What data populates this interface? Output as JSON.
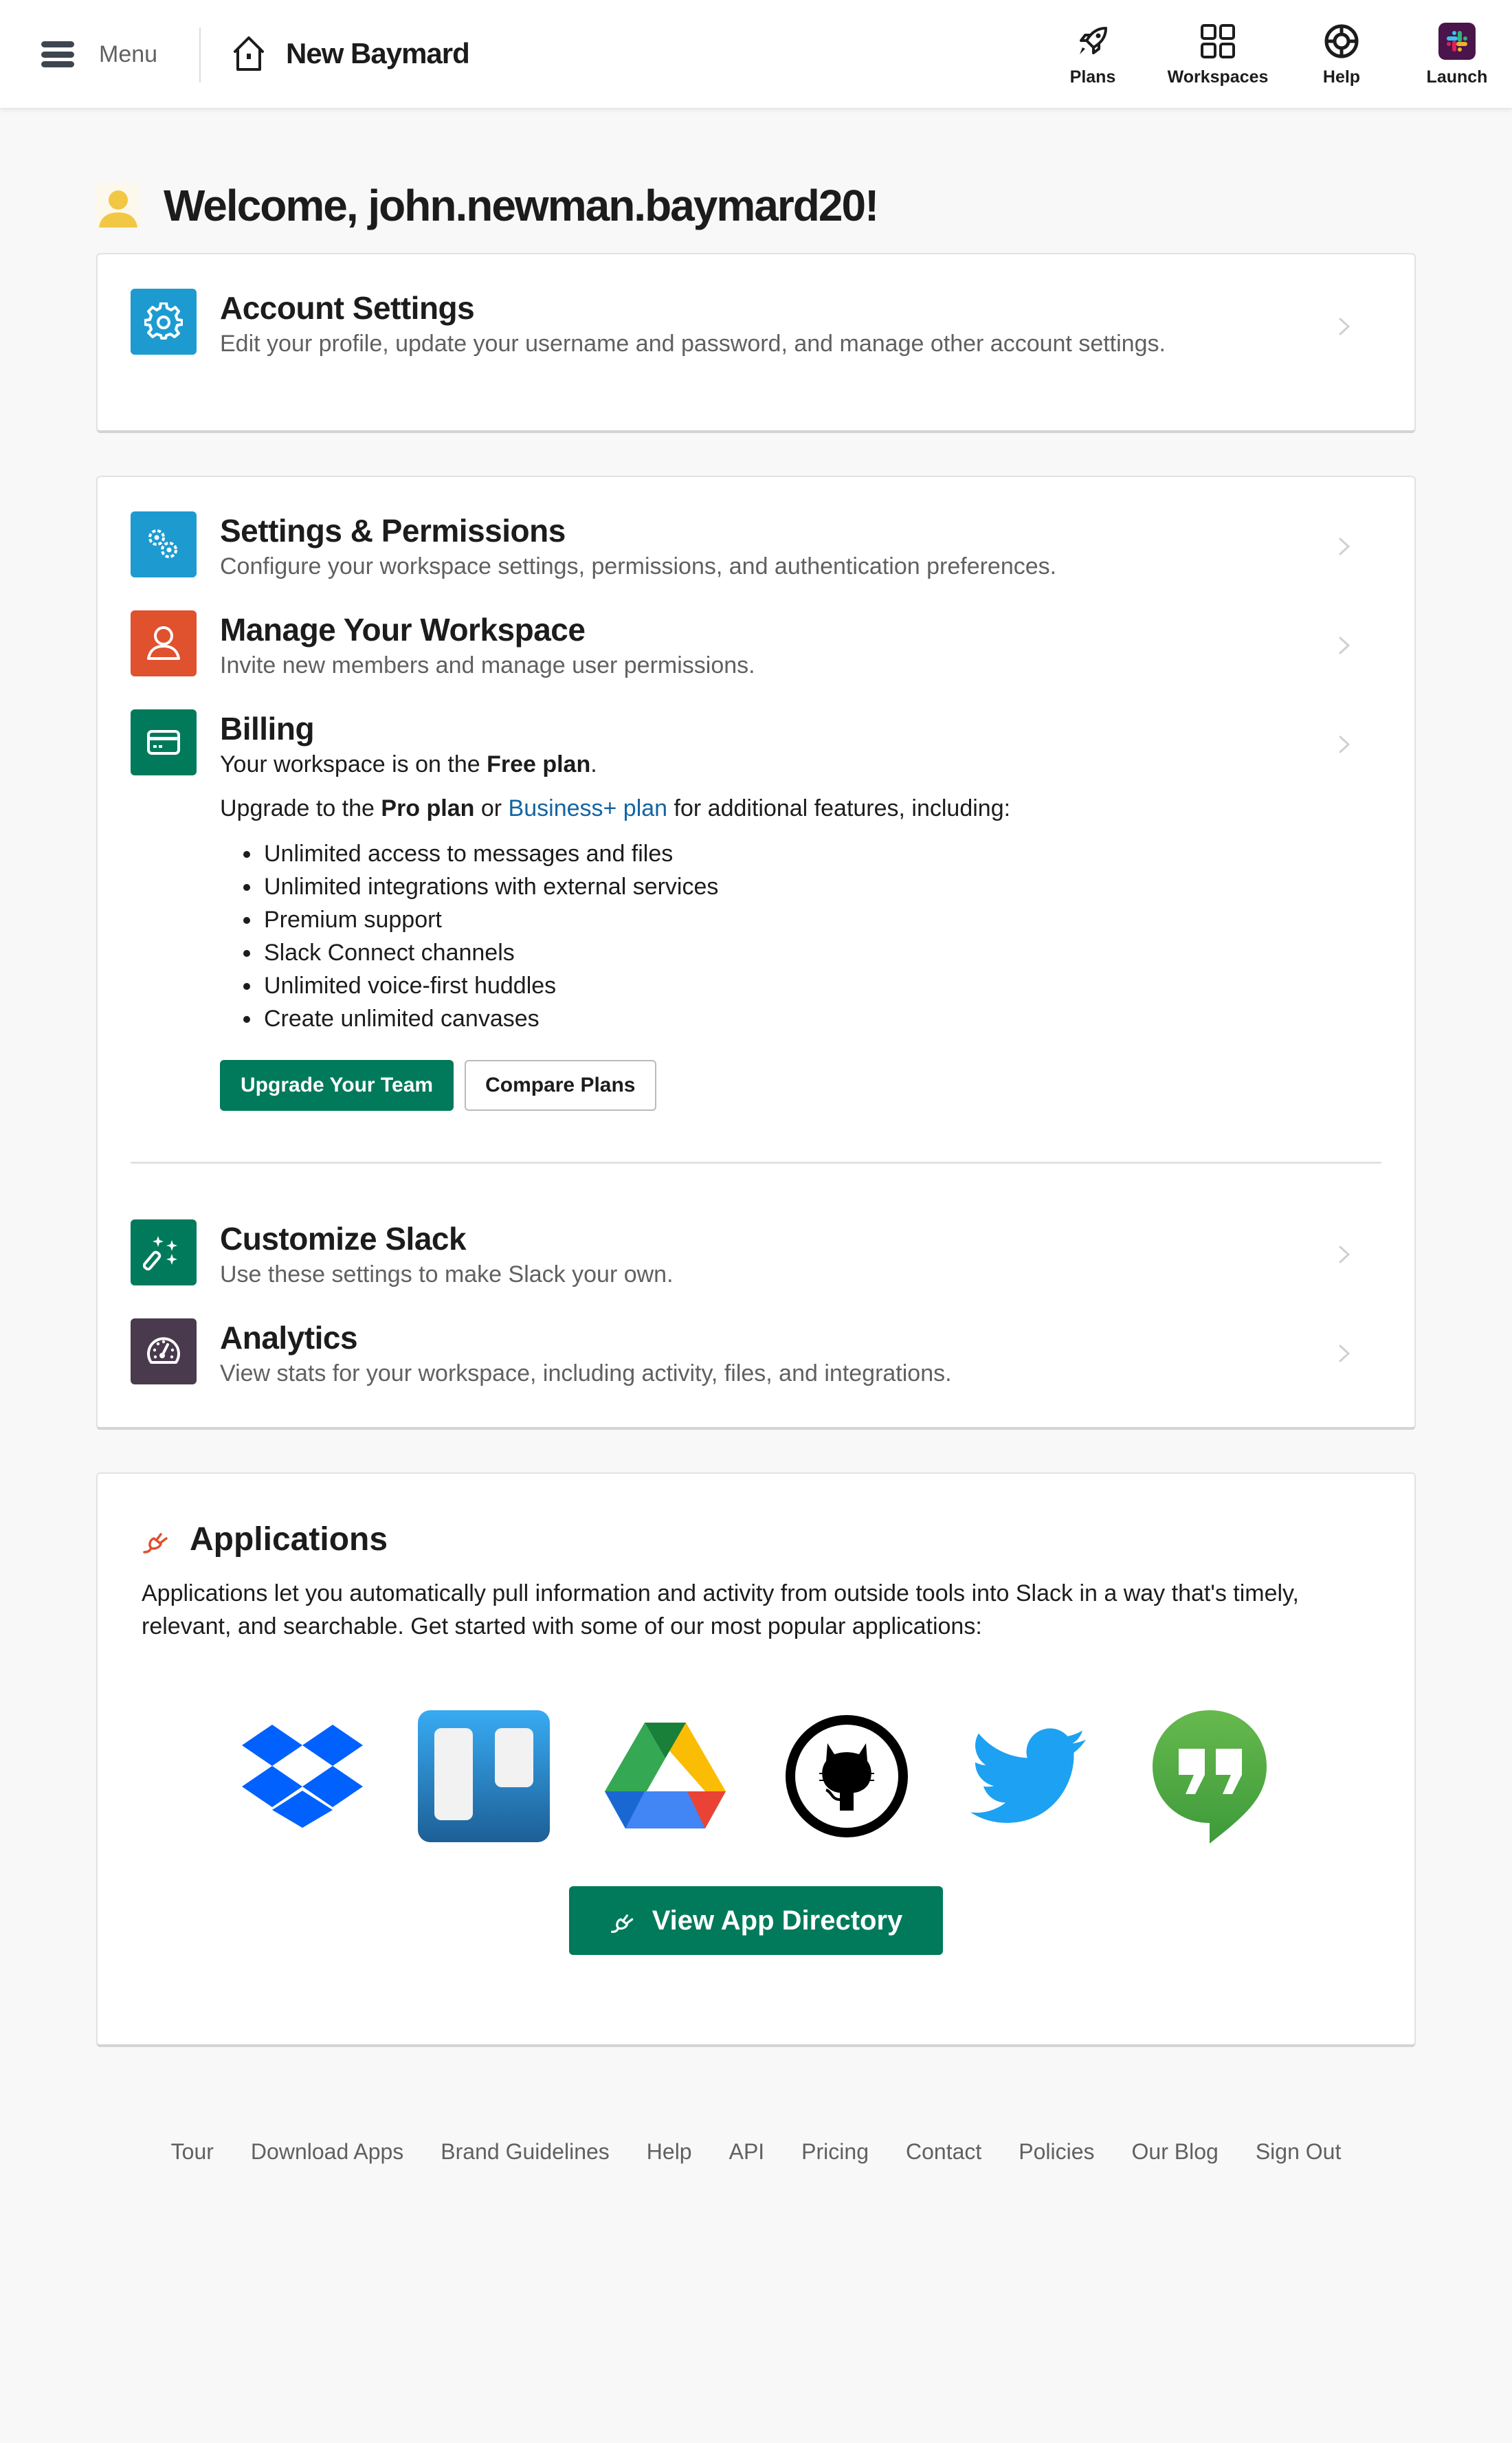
{
  "topbar": {
    "menu_label": "Menu",
    "workspace_name": "New Baymard",
    "nav": [
      {
        "label": "Plans",
        "icon": "rocket-icon"
      },
      {
        "label": "Workspaces",
        "icon": "grid-icon"
      },
      {
        "label": "Help",
        "icon": "lifebuoy-icon"
      },
      {
        "label": "Launch",
        "icon": "slack-logo-icon"
      }
    ]
  },
  "welcome": {
    "title": "Welcome, john.newman.baymard20!",
    "avatar_color": "#f2c744"
  },
  "account_settings": {
    "title": "Account Settings",
    "description": "Edit your profile, update your username and password, and manage other account settings.",
    "icon": "gear-icon",
    "color": "#1d9bd1"
  },
  "workspace_sections": [
    {
      "title": "Settings & Permissions",
      "description": "Configure your workspace settings, permissions, and authentication preferences.",
      "icon": "gears-icon",
      "color": "#1d9bd1"
    },
    {
      "title": "Manage Your Workspace",
      "description": "Invite new members and manage user permissions.",
      "icon": "user-icon",
      "color": "#e0512e"
    },
    {
      "title": "Billing",
      "icon": "credit-card-icon",
      "color": "#007a5a"
    }
  ],
  "billing": {
    "current_plan_prefix": "Your workspace is on the ",
    "current_plan": "Free plan",
    "current_plan_suffix": ".",
    "upgrade_prefix": "Upgrade to the ",
    "pro_plan": "Pro plan",
    "or": " or ",
    "business_plan": "Business+ plan",
    "upgrade_suffix": " for additional features, including:",
    "features": [
      "Unlimited access to messages and files",
      "Unlimited integrations with external services",
      "Premium support",
      "Slack Connect channels",
      "Unlimited voice-first huddles",
      "Create unlimited canvases"
    ],
    "upgrade_button": "Upgrade Your Team",
    "compare_button": "Compare Plans"
  },
  "customize_sections": [
    {
      "title": "Customize Slack",
      "description": "Use these settings to make Slack your own.",
      "icon": "magic-wand-icon",
      "color": "#007a5a"
    },
    {
      "title": "Analytics",
      "description": "View stats for your workspace, including activity, files, and integrations.",
      "icon": "speedometer-icon",
      "color": "#4a3a4e"
    }
  ],
  "applications": {
    "title": "Applications",
    "description": "Applications let you automatically pull information and activity from outside tools into Slack in a way that's timely, relevant, and searchable. Get started with some of our most popular applications:",
    "apps": [
      "Dropbox",
      "Trello",
      "Google Drive",
      "GitHub",
      "Twitter",
      "Google Hangouts"
    ],
    "directory_button": "View App Directory",
    "accent_color": "#e0512e"
  },
  "footer": {
    "links": [
      "Tour",
      "Download Apps",
      "Brand Guidelines",
      "Help",
      "API",
      "Pricing",
      "Contact",
      "Policies",
      "Our Blog",
      "Sign Out"
    ]
  }
}
